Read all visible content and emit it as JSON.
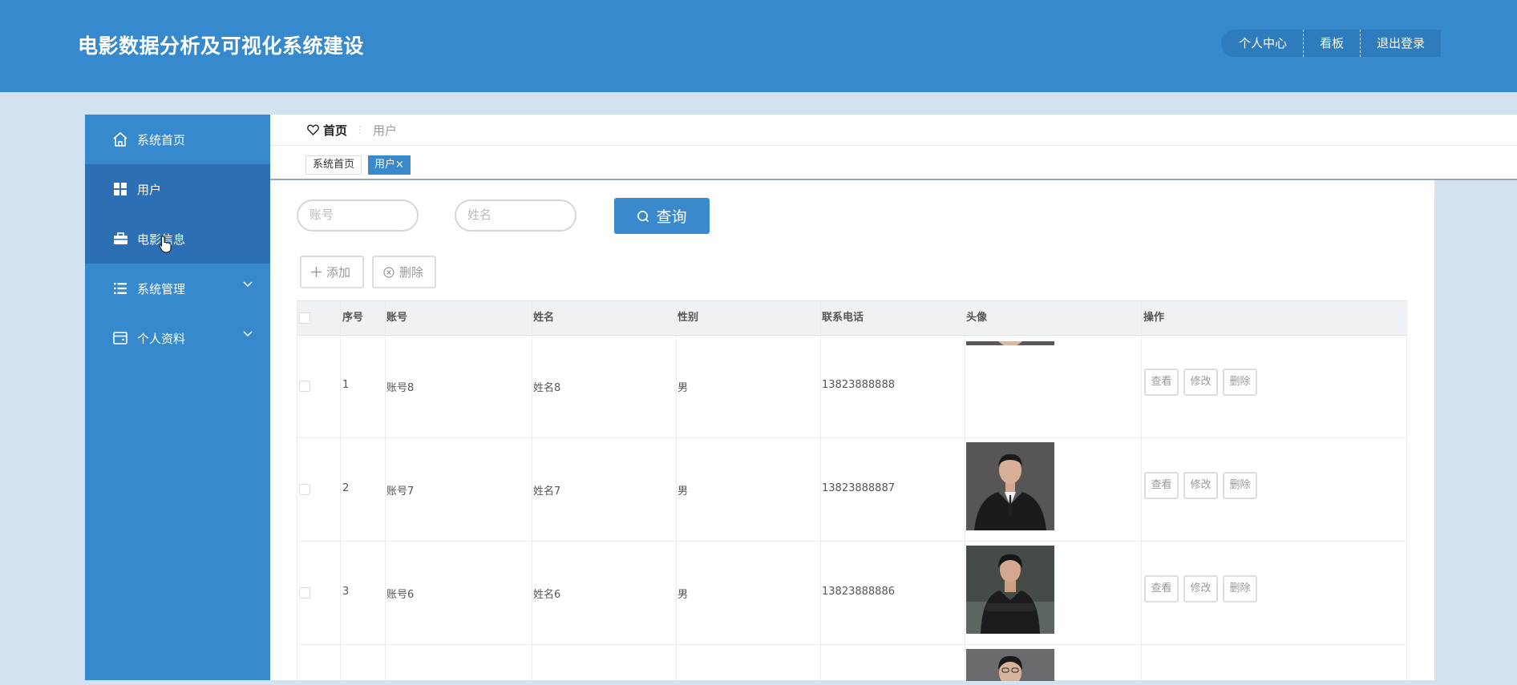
{
  "header": {
    "title": "电影数据分析及可视化系统建设",
    "nav": [
      "个人中心",
      "看板",
      "退出登录"
    ]
  },
  "sidebar": {
    "items": [
      {
        "label": "系统首页",
        "icon": "home-icon"
      },
      {
        "label": "用户",
        "icon": "grid-icon"
      },
      {
        "label": "电影信息",
        "icon": "briefcase-icon"
      },
      {
        "label": "系统管理",
        "icon": "list-icon"
      },
      {
        "label": "个人资料",
        "icon": "card-icon"
      }
    ]
  },
  "breadcrumb": {
    "home": "首页",
    "separator": "⋮",
    "current": "用户"
  },
  "tabs": [
    {
      "label": "系统首页"
    },
    {
      "label": "用户",
      "close": "×"
    }
  ],
  "search": {
    "account_placeholder": "账号",
    "name_placeholder": "姓名",
    "query_label": "查询"
  },
  "actions": {
    "add_label": "添加",
    "delete_label": "删除"
  },
  "table": {
    "headers": [
      "序号",
      "账号",
      "姓名",
      "性别",
      "联系电话",
      "头像",
      "操作"
    ],
    "rows": [
      {
        "index": "1",
        "account": "账号8",
        "name": "姓名8",
        "gender": "男",
        "phone": "13823888888"
      },
      {
        "index": "2",
        "account": "账号7",
        "name": "姓名7",
        "gender": "男",
        "phone": "13823888887"
      },
      {
        "index": "3",
        "account": "账号6",
        "name": "姓名6",
        "gender": "男",
        "phone": "13823888886"
      }
    ],
    "row_actions": [
      "查看",
      "修改",
      "删除"
    ]
  },
  "colors": {
    "primary": "#3689cc",
    "active": "#2d6fb5",
    "background": "#d3e2f1"
  }
}
